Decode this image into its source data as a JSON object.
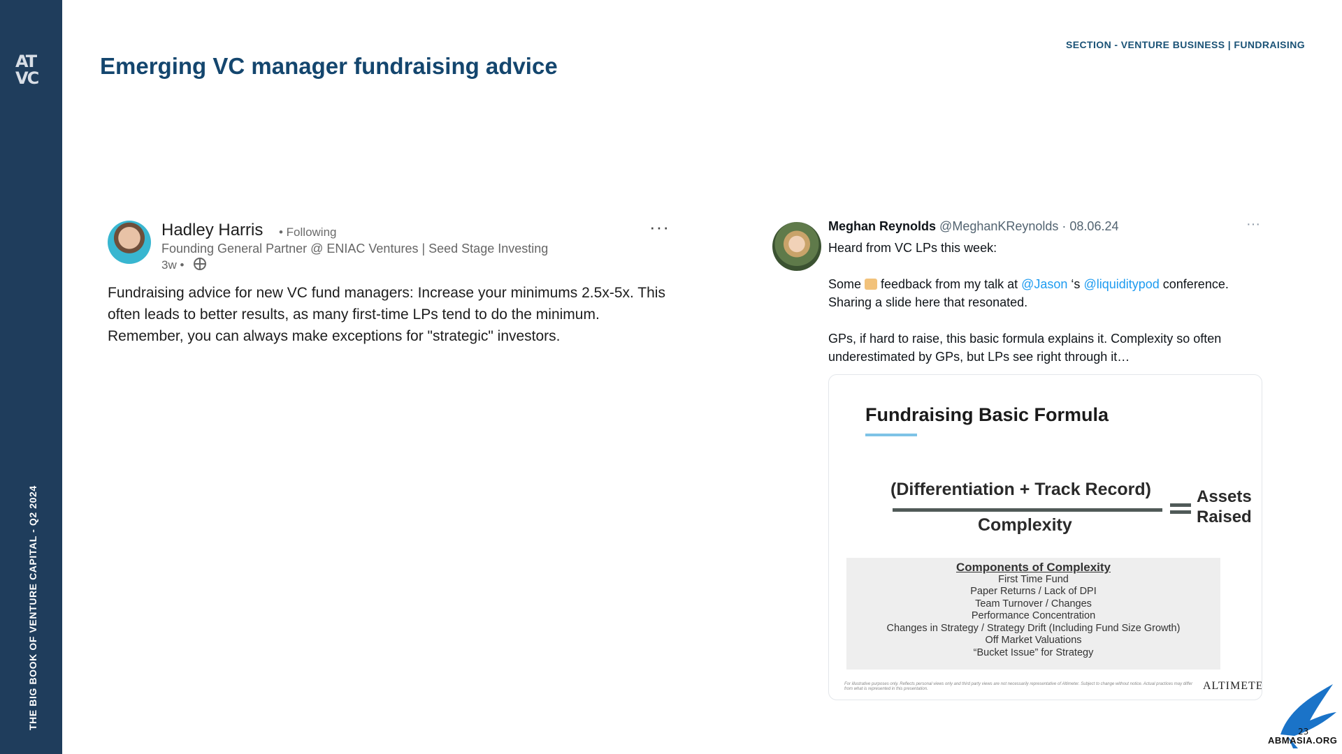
{
  "sidebar": {
    "logo_text": "ATVC",
    "vertical_text": "THE BIG BOOK OF VENTURE CAPITAL - Q2 2024",
    "color": "#1f3d5c"
  },
  "header": {
    "section_label": "SECTION - VENTURE BUSINESS | FUNDRAISING",
    "title": "Emerging VC manager fundraising advice"
  },
  "linkedin_post": {
    "author": "Hadley Harris",
    "following": "• Following",
    "headline": "Founding General Partner @ ENIAC Ventures | Seed Stage Investing",
    "time": "3w •",
    "more": "···",
    "body": "Fundraising advice for new VC fund managers: Increase your minimums 2.5x-5x. This often leads to better results, as many first-time LPs tend to do the minimum. Remember, you can always make exceptions for \"strategic\" investors."
  },
  "twitter_post": {
    "name": "Meghan Reynolds",
    "handle": "@MeghanKReynolds · 08.06.24",
    "more": "···",
    "line1": "Heard from VC LPs this week:",
    "line2_prefix": "Some ",
    "line2_mid": " feedback from my talk at ",
    "mention1": "@Jason",
    "line2_sep": " ‘s ",
    "mention2": "@liquiditypod",
    "line2_suffix": " conference. Sharing a slide here that resonated.",
    "line3": "GPs, if hard to raise, this basic formula explains it. Complexity so often underestimated by GPs, but LPs see right through it…",
    "mention_color": "#1d9bf0"
  },
  "slide": {
    "title": "Fundraising Basic Formula",
    "numerator": "(Differentiation + Track Record)",
    "denominator": "Complexity",
    "result_line1": "Assets",
    "result_line2": "Raised",
    "components_title": "Components of Complexity",
    "components": [
      "First Time Fund",
      "Paper Returns / Lack of DPI",
      "Team Turnover / Changes",
      "Performance Concentration",
      "Changes in Strategy / Strategy Drift (Including Fund Size Growth)",
      "Off Market Valuations",
      "“Bucket Issue” for Strategy"
    ],
    "disclaimer": "For illustrative purposes only. Reflects personal views only and third party views are not necessarily representative of Altimeter. Subject to change without notice. Actual practices may differ from what is represented in this presentation.",
    "brand": "ALTIMETE"
  },
  "watermark": {
    "text": "ABMASIA.ORG",
    "number": "23"
  }
}
